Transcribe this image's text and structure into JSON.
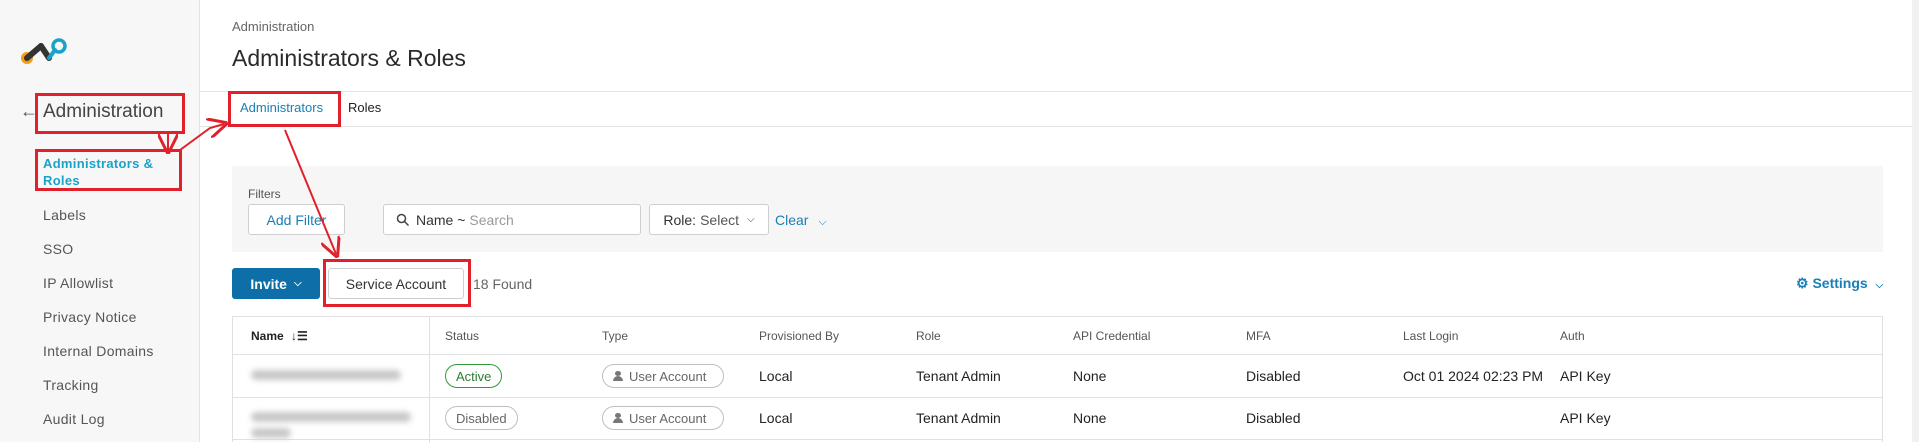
{
  "sidebar": {
    "title": "Administration",
    "items": [
      {
        "label": "Administrators & Roles",
        "active": true
      },
      {
        "label": "Labels"
      },
      {
        "label": "SSO"
      },
      {
        "label": "IP Allowlist"
      },
      {
        "label": "Privacy Notice"
      },
      {
        "label": "Internal Domains"
      },
      {
        "label": "Tracking"
      },
      {
        "label": "Audit Log"
      }
    ]
  },
  "header": {
    "breadcrumb": "Administration",
    "title": "Administrators & Roles"
  },
  "tabs": [
    {
      "label": "Administrators",
      "active": true
    },
    {
      "label": "Roles"
    }
  ],
  "filters": {
    "label": "Filters",
    "add_filter": "Add Filter",
    "search_field": "Name ~",
    "search_placeholder": "Search",
    "role_label": "Role:",
    "role_value": "Select",
    "clear": "Clear"
  },
  "toolbar": {
    "invite": "Invite",
    "service_account": "Service Account",
    "found": "18 Found",
    "settings": "Settings"
  },
  "table": {
    "columns": [
      "Name",
      "Status",
      "Type",
      "Provisioned By",
      "Role",
      "API Credential",
      "MFA",
      "Last Login",
      "Auth"
    ],
    "rows": [
      {
        "status": "Active",
        "type": "User Account",
        "provisioned_by": "Local",
        "role": "Tenant Admin",
        "api_credential": "None",
        "mfa": "Disabled",
        "last_login": "Oct 01 2024 02:23 PM",
        "auth": "API Key"
      },
      {
        "status": "Disabled",
        "type": "User Account",
        "provisioned_by": "Local",
        "role": "Tenant Admin",
        "api_credential": "None",
        "mfa": "Disabled",
        "last_login": "",
        "auth": "API Key"
      }
    ]
  },
  "colors": {
    "accent": "#1a7fb5",
    "active_nav": "#1aa3c9",
    "invite_bg": "#0e6fa8",
    "annotation": "#e0202a",
    "status_active": "#2f9a3c"
  },
  "icons": [
    "logo-icon",
    "back-arrow-icon",
    "search-icon",
    "chevron-down-icon",
    "sort-icon",
    "gear-icon",
    "user-icon"
  ]
}
